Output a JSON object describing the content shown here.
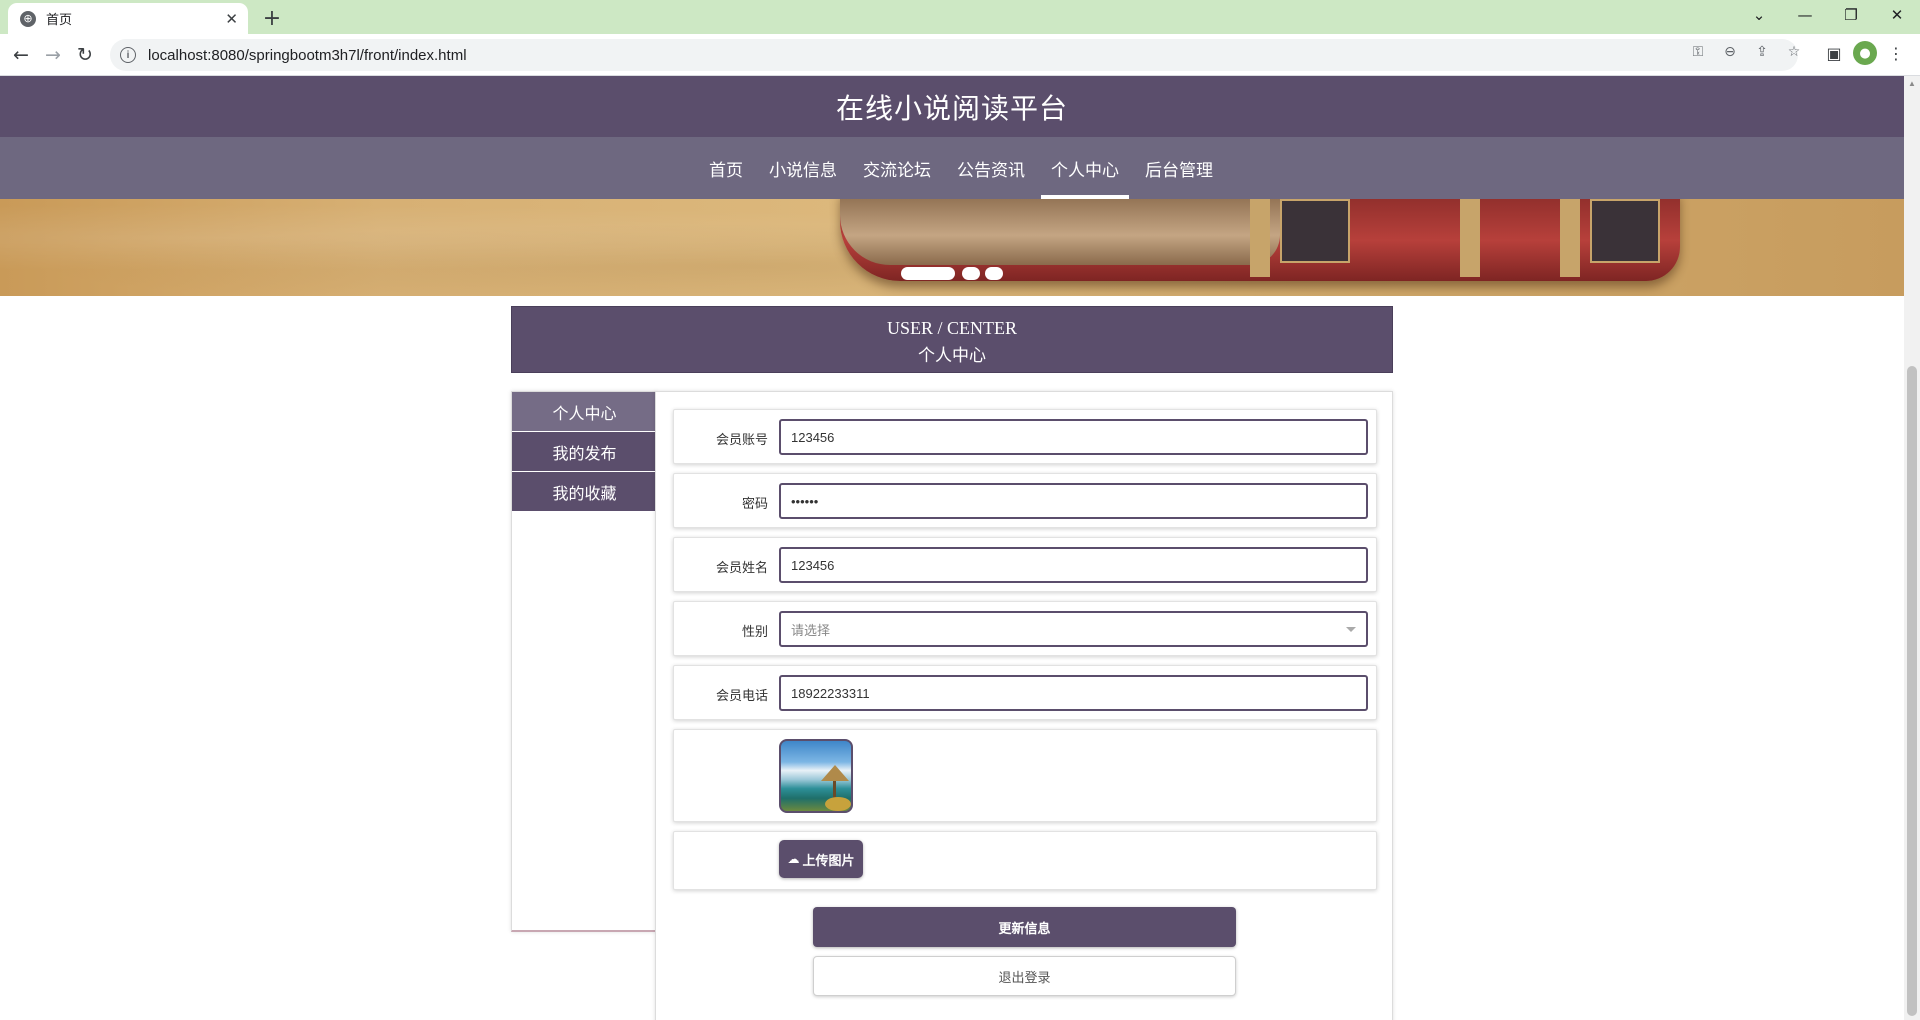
{
  "browser": {
    "tab_title": "首页",
    "tab_favicon": "globe-icon",
    "new_tab_label": "+",
    "url": "localhost:8080/springbootm3h7l/front/index.html"
  },
  "site": {
    "title": "在线小说阅读平台",
    "nav": [
      {
        "label": "首页",
        "active": false
      },
      {
        "label": "小说信息",
        "active": false
      },
      {
        "label": "交流论坛",
        "active": false
      },
      {
        "label": "公告资讯",
        "active": false
      },
      {
        "label": "个人中心",
        "active": true
      },
      {
        "label": "后台管理",
        "active": false
      }
    ],
    "banner": {
      "slide_count": 3,
      "active_slide": 1
    }
  },
  "center": {
    "title_en": "USER / CENTER",
    "title_cn": "个人中心"
  },
  "sidebar": {
    "items": [
      {
        "label": "个人中心",
        "active": true
      },
      {
        "label": "我的发布",
        "active": false
      },
      {
        "label": "我的收藏",
        "active": false
      }
    ]
  },
  "form": {
    "account_label": "会员账号",
    "account_value": "123456",
    "password_label": "密码",
    "password_value": "••••••",
    "name_label": "会员姓名",
    "name_value": "123456",
    "gender_label": "性别",
    "gender_placeholder": "请选择",
    "phone_label": "会员电话",
    "phone_value": "18922233311",
    "upload_label": "上传图片",
    "update_label": "更新信息",
    "logout_label": "退出登录"
  },
  "colors": {
    "primary": "#5b4e6c",
    "nav_bg": "#6e6880",
    "sidebar_active": "#756c86",
    "browser_tabbar": "#cde8c4"
  }
}
